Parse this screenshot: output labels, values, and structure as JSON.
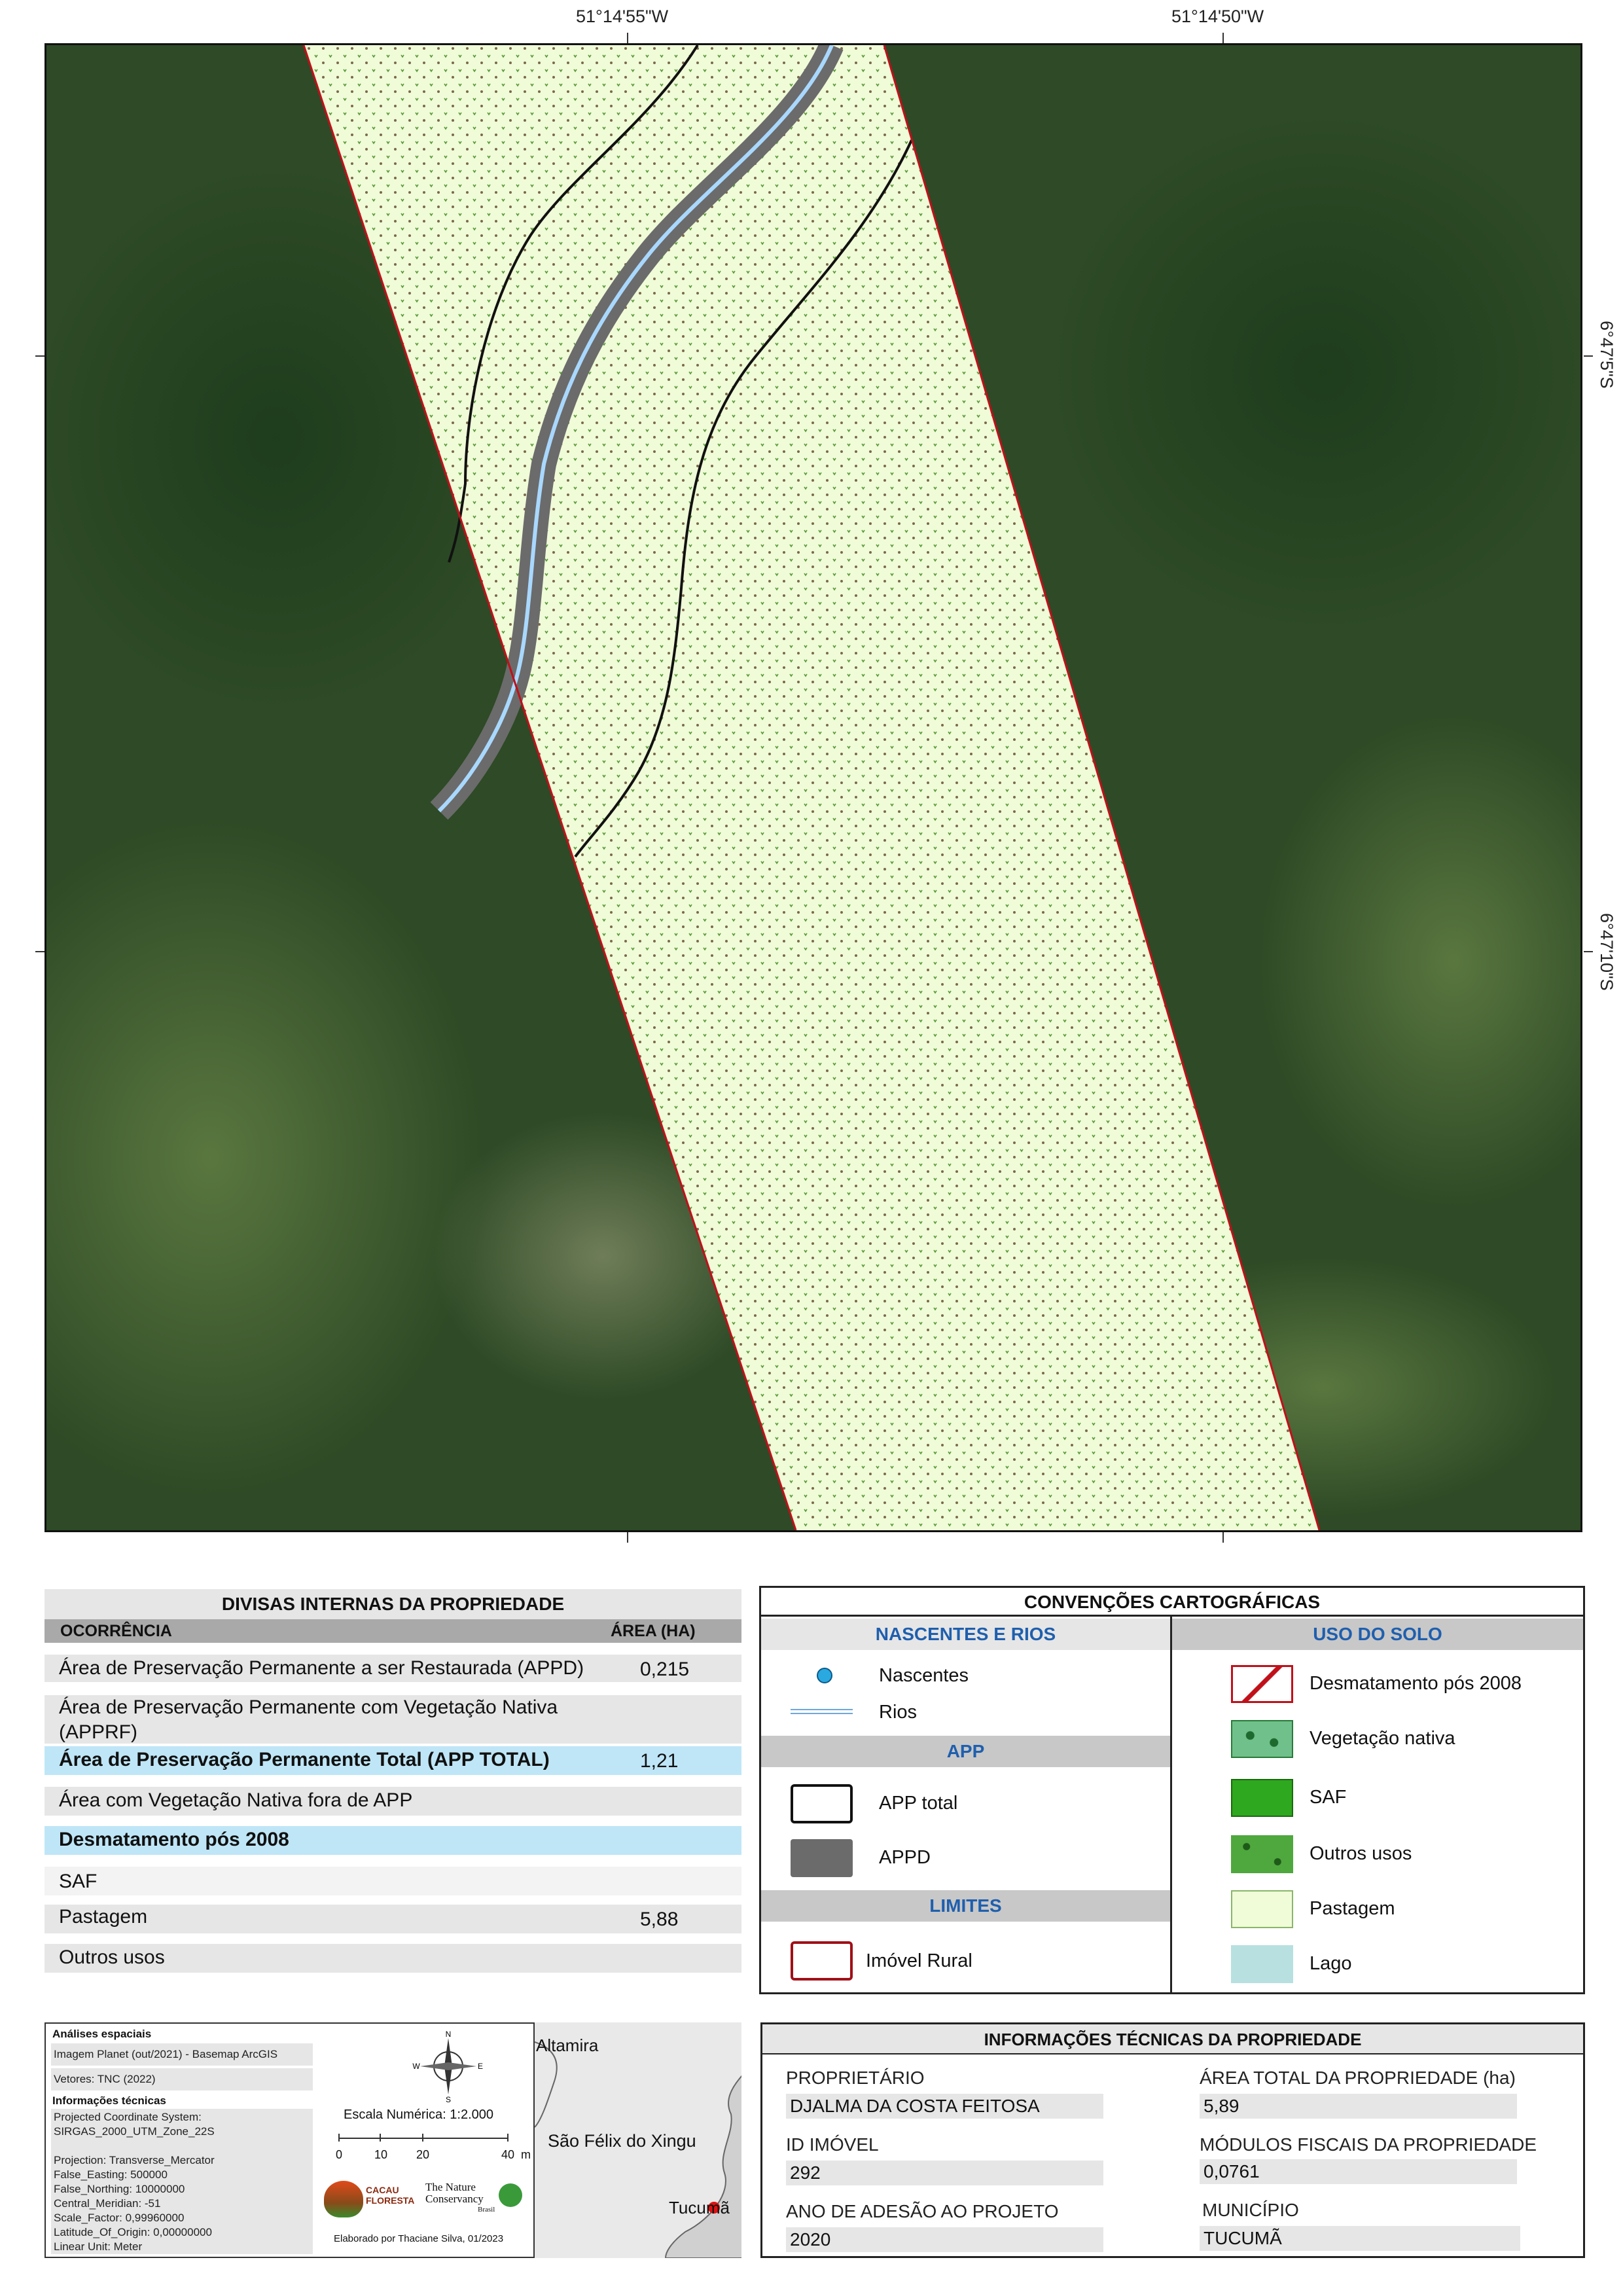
{
  "coordinates": {
    "top_left": "51°14'55\"W",
    "top_right": "51°14'50\"W",
    "right_upper": "6°47'5\"S",
    "right_lower": "6°47'10\"S"
  },
  "divisas": {
    "title": "DIVISAS INTERNAS DA PROPRIEDADE",
    "col_ocorrencia": "OCORRÊNCIA",
    "col_area": "ÁREA (HA)",
    "rows": [
      {
        "label": "Área de Preservação Permanente a ser Restaurada (APPD)",
        "value": "0,215"
      },
      {
        "label": "Área de Preservação Permanente com Vegetação Nativa (APPRF)",
        "value": ""
      },
      {
        "label": "Área de Preservação Permanente Total (APP TOTAL)",
        "value": "1,21"
      },
      {
        "label": "Área com Vegetação Nativa fora de APP",
        "value": ""
      },
      {
        "label": "Desmatamento pós 2008",
        "value": ""
      },
      {
        "label": "SAF",
        "value": ""
      },
      {
        "label": "Pastagem",
        "value": "5,88"
      },
      {
        "label": "Outros usos",
        "value": ""
      }
    ]
  },
  "convencoes": {
    "title": "CONVENÇÕES CARTOGRÁFICAS",
    "nascentes_header": "NASCENTES E RIOS",
    "nascentes": "Nascentes",
    "rios": "Rios",
    "app_header": "APP",
    "app_total": "APP total",
    "appd": "APPD",
    "limites_header": "LIMITES",
    "imovel": "Imóvel Rural",
    "uso_header": "USO DO SOLO",
    "uso": [
      "Desmatamento pós 2008",
      "Vegetação nativa",
      "SAF",
      "Outros usos",
      "Pastagem",
      "Lago"
    ]
  },
  "analises": {
    "title": "Análises espaciais",
    "imagem": "Imagem Planet (out/2021) - Basemap ArcGIS",
    "vetores": "Vetores: TNC (2022)",
    "info_title": "Informações técnicas",
    "tech": [
      "Projected Coordinate System:",
      "SIRGAS_2000_UTM_Zone_22S",
      "",
      "Projection: Transverse_Mercator",
      "False_Easting: 500000",
      "False_Northing: 10000000",
      "Central_Meridian: -51",
      "Scale_Factor: 0,99960000",
      "Latitude_Of_Origin: 0,00000000",
      "Linear Unit:  Meter"
    ],
    "scale_text": "Escala Numérica: 1:2.000",
    "scale_ticks": [
      "0",
      "10",
      "20",
      "40"
    ],
    "scale_unit": "m",
    "credit": "Elaborado por Thaciane Silva, 01/2023",
    "logo_cacau": "CACAU FLORESTA",
    "logo_tnc_1": "The Nature",
    "logo_tnc_2": "Conservancy",
    "logo_tnc_3": "Brasil",
    "compass": {
      "n": "N",
      "s": "S",
      "e": "E",
      "w": "W"
    },
    "locator": [
      "Altamira",
      "São Félix do Xingu",
      "Tucumã"
    ]
  },
  "info": {
    "title": "INFORMAÇÕES TÉCNICAS DA PROPRIEDADE",
    "proprietario_label": "PROPRIETÁRIO",
    "proprietario": "DJALMA DA COSTA FEITOSA",
    "area_label": "ÁREA TOTAL DA PROPRIEDADE (ha)",
    "area": "5,89",
    "id_label": "ID IMÓVEL",
    "id": "292",
    "modulos_label": "MÓDULOS FISCAIS DA PROPRIEDADE",
    "modulos": "0,0761",
    "ano_label": "ANO DE ADESÃO AO PROJETO",
    "ano": "2020",
    "municipio_label": "MUNICÍPIO",
    "municipio": "TUCUMÃ"
  },
  "colors": {
    "pastagem": "#f0fbd8",
    "boundary": "#c0101a",
    "appd": "#6b6b6b",
    "river": "#a9d8ff",
    "header_blue": "#1f5fae",
    "highlight": "#bfe6f7"
  }
}
